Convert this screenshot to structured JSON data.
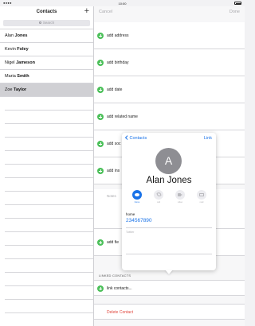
{
  "status": {
    "time": "10:00",
    "dots": "●●●●"
  },
  "left": {
    "title": "Contacts",
    "add_label": "+",
    "search_placeholder": "Search",
    "contacts": [
      {
        "first": "Alan",
        "last": "Jones",
        "selected": false
      },
      {
        "first": "Kevin",
        "last": "Foley",
        "selected": false
      },
      {
        "first": "Nigel",
        "last": "Jameson",
        "selected": false
      },
      {
        "first": "Maria",
        "last": "Smith",
        "selected": false
      },
      {
        "first": "Zoe",
        "last": "Taylor",
        "selected": true
      }
    ]
  },
  "editor": {
    "cancel": "Cancel",
    "done": "Done",
    "fields": [
      {
        "label": "add address"
      },
      {
        "label": "add birthday"
      },
      {
        "label": "add date"
      },
      {
        "label": "add related name"
      },
      {
        "label": "add soc"
      },
      {
        "label": "add ins"
      },
      {
        "label": "add fie"
      }
    ],
    "notes_label": "Notes",
    "linked_header": "LINKED CONTACTS",
    "link_contacts": "link contacts...",
    "delete": "Delete Contact"
  },
  "popover": {
    "back_label": "Contacts",
    "link_label": "Link",
    "avatar_initial": "A",
    "name": "Alan Jones",
    "actions": [
      {
        "caption": "home",
        "icon": "message-icon",
        "active": true
      },
      {
        "caption": "call",
        "icon": "phone-icon",
        "active": false
      },
      {
        "caption": "video",
        "icon": "video-icon",
        "active": false
      },
      {
        "caption": "mail",
        "icon": "mail-icon",
        "active": false
      }
    ],
    "phone_label": "home",
    "phone_number": "234567890",
    "twitter_label": "Twitter"
  },
  "colors": {
    "accent": "#1a73e8",
    "add": "#4cc05a",
    "destructive": "#e0473d"
  }
}
